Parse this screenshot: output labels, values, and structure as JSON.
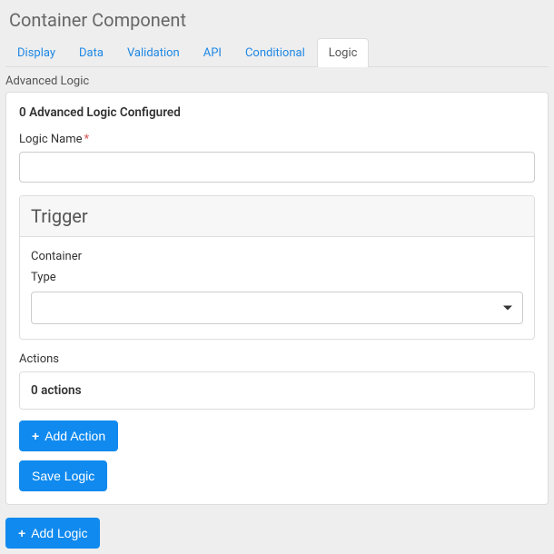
{
  "title": "Container Component",
  "tabs": [
    {
      "label": "Display",
      "active": false
    },
    {
      "label": "Data",
      "active": false
    },
    {
      "label": "Validation",
      "active": false
    },
    {
      "label": "API",
      "active": false
    },
    {
      "label": "Conditional",
      "active": false
    },
    {
      "label": "Logic",
      "active": true
    }
  ],
  "section_label": "Advanced Logic",
  "count_header": "0 Advanced Logic Configured",
  "logic_name": {
    "label": "Logic Name",
    "value": ""
  },
  "trigger": {
    "header": "Trigger",
    "container_label": "Container",
    "type_label": "Type",
    "type_value": ""
  },
  "actions": {
    "label": "Actions",
    "count_text": "0 actions"
  },
  "buttons": {
    "add_action": "Add Action",
    "save_logic": "Save Logic",
    "add_logic": "Add Logic"
  }
}
